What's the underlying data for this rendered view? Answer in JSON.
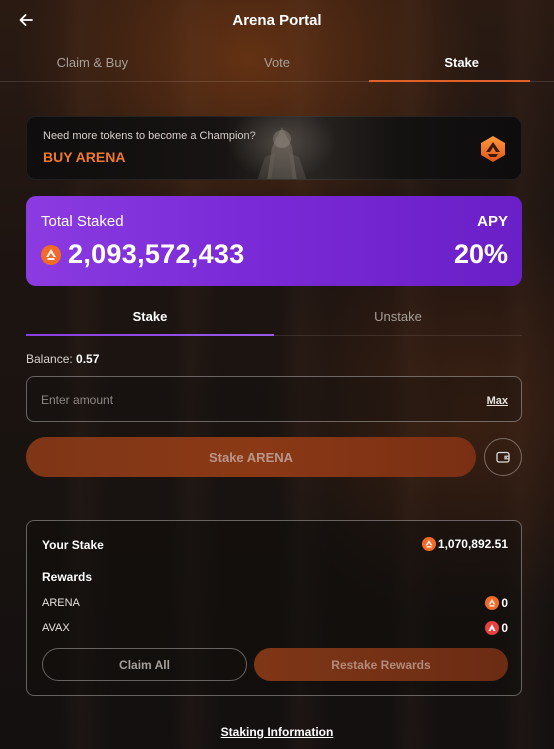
{
  "header": {
    "title": "Arena Portal",
    "back_icon": "arrow-left-icon"
  },
  "tabs": [
    {
      "label": "Claim & Buy",
      "active": false
    },
    {
      "label": "Vote",
      "active": false
    },
    {
      "label": "Stake",
      "active": true
    }
  ],
  "promo": {
    "text": "Need more tokens to become a Champion?",
    "cta": "BUY ARENA",
    "logo_icon": "arena-logo-icon"
  },
  "total": {
    "label": "Total Staked",
    "value": "2,093,572,433",
    "apy_label": "APY",
    "apy_value": "20%",
    "icon": "arena-token-icon"
  },
  "subtabs": [
    {
      "label": "Stake",
      "active": true
    },
    {
      "label": "Unstake",
      "active": false
    }
  ],
  "balance": {
    "label": "Balance:",
    "value": "0.57"
  },
  "amount_input": {
    "placeholder": "Enter amount",
    "value": "",
    "max_label": "Max"
  },
  "stake_button": {
    "label": "Stake ARENA",
    "wallet_icon": "wallet-icon"
  },
  "your_stake": {
    "label": "Your Stake",
    "value": "1,070,892.51",
    "rewards_label": "Rewards",
    "rewards": [
      {
        "name": "ARENA",
        "value": "0",
        "icon": "arena-token-icon"
      },
      {
        "name": "AVAX",
        "value": "0",
        "icon": "avax-token-icon"
      }
    ],
    "claim_label": "Claim All",
    "restake_label": "Restake Rewards"
  },
  "footer": {
    "staking_info": "Staking Information"
  },
  "colors": {
    "accent_orange": "#f07a2c",
    "tab_underline": "#e2602a",
    "purple_card": "#7a2ad6",
    "avax_red": "#e84142"
  }
}
